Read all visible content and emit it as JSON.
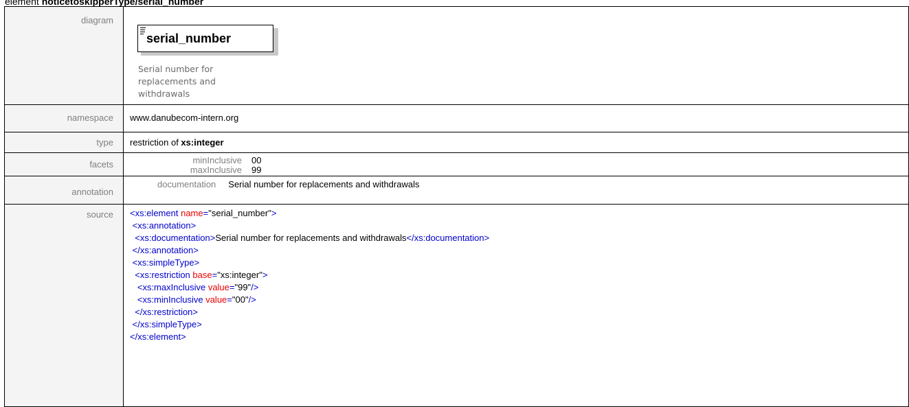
{
  "heading": {
    "prefix": "element ",
    "name": "noticetoskipperType/serial_number"
  },
  "rows": {
    "diagram": {
      "label": "diagram",
      "element_name": "serial_number",
      "documentation_lines": [
        "Serial number for",
        "replacements and",
        "withdrawals"
      ]
    },
    "namespace": {
      "label": "namespace",
      "value": "www.danubecom-intern.org"
    },
    "type": {
      "label": "type",
      "prefix": "restriction of ",
      "base": "xs:integer"
    },
    "facets": {
      "label": "facets",
      "items": [
        {
          "name": "minInclusive",
          "value": "00"
        },
        {
          "name": "maxInclusive",
          "value": "99"
        }
      ]
    },
    "annotation": {
      "label": "annotation",
      "name": "documentation",
      "value": "Serial number for replacements and withdrawals"
    },
    "source": {
      "label": "source",
      "lines": [
        "<xs:element name=\"serial_number\">",
        " <xs:annotation>",
        "  <xs:documentation>Serial number for replacements and withdrawals</xs:documentation>",
        " </xs:annotation>",
        " <xs:simpleType>",
        "  <xs:restriction base=\"xs:integer\">",
        "   <xs:maxInclusive value=\"99\"/>",
        "   <xs:minInclusive value=\"00\"/>",
        "  </xs:restriction>",
        " </xs:simpleType>",
        "</xs:element>"
      ]
    }
  }
}
